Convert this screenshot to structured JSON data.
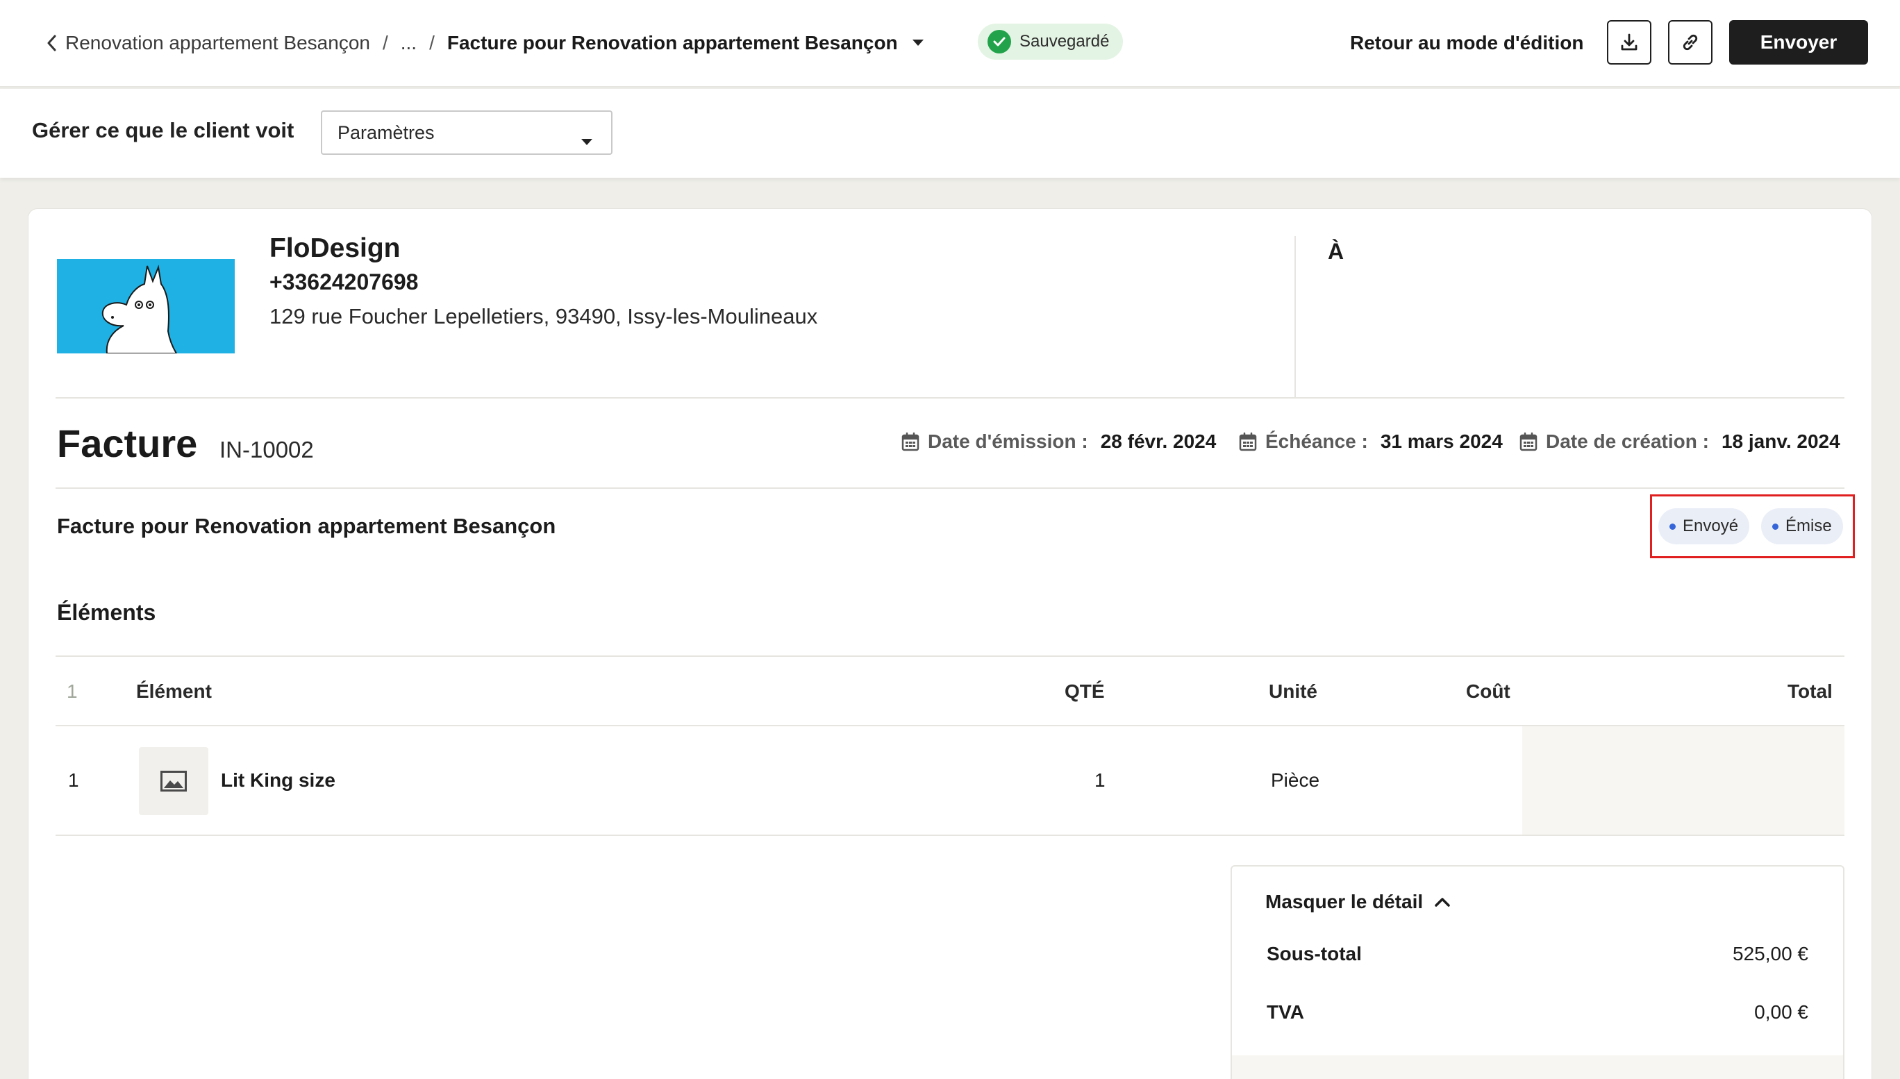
{
  "breadcrumb": {
    "project": "Renovation appartement Besançon",
    "ellipsis": "...",
    "separator": "/",
    "current": "Facture pour Renovation appartement Besançon"
  },
  "status": {
    "saved_label": "Sauvegardé",
    "saved_color": "#22a24a"
  },
  "toolbar": {
    "edit_mode_label": "Retour au mode d'édition",
    "send_label": "Envoyer",
    "download_icon": "download-icon",
    "link_icon": "link-icon"
  },
  "visibility": {
    "label": "Gérer ce que le client voit",
    "selected": "Paramètres"
  },
  "company": {
    "name": "FloDesign",
    "phone": "+33624207698",
    "address": "129 rue Foucher Lepelletiers, 93490, Issy-les-Moulineaux",
    "logo_color": "#1fb1e3"
  },
  "recipient": {
    "label": "À"
  },
  "invoice": {
    "title": "Facture",
    "number": "IN-10002",
    "subtitle": "Facture pour Renovation appartement Besançon",
    "meta": [
      {
        "label": "Date d'émission :",
        "value": "28 févr. 2024"
      },
      {
        "label": "Échéance :",
        "value": "31 mars 2024"
      },
      {
        "label": "Date de création :",
        "value": "18 janv. 2024"
      }
    ],
    "badges": [
      {
        "label": "Envoyé",
        "color": "#3565d8"
      },
      {
        "label": "Émise",
        "color": "#3565d8"
      }
    ]
  },
  "items": {
    "section_title": "Éléments",
    "columns": {
      "index": "1",
      "element": "Élément",
      "qty": "QTÉ",
      "unit": "Unité",
      "cost": "Coût",
      "total": "Total"
    },
    "rows": [
      {
        "index": "1",
        "name": "Lit King size",
        "qty": "1",
        "unit": "Pièce",
        "cost": "",
        "total": ""
      }
    ]
  },
  "summary": {
    "toggle_label": "Masquer le détail",
    "rows": [
      {
        "label": "Sous-total",
        "value": "525,00 €"
      },
      {
        "label": "TVA",
        "value": "0,00 €"
      }
    ]
  }
}
